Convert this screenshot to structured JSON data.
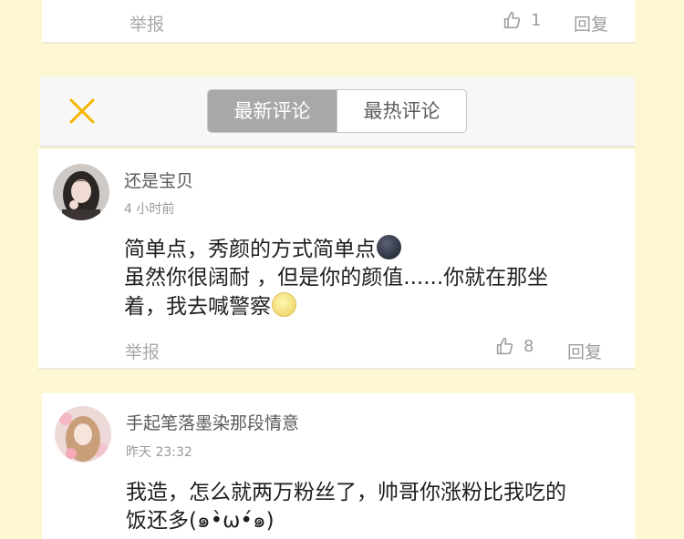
{
  "top_card": {
    "report_label": "举报",
    "like_count": "1",
    "reply_label": "回复"
  },
  "tabs": {
    "latest_label": "最新评论",
    "hot_label": "最热评论",
    "active": "latest"
  },
  "comments": [
    {
      "username": "还是宝贝",
      "time": "4 小时前",
      "lines": [
        "简单点，秀颜的方式简单点",
        "虽然你很阔耐 ，但是你的颜值......你就在那坐",
        "着，我去喊警察"
      ],
      "emojis": [
        "new-moon-face-icon",
        "full-moon-face-icon"
      ],
      "report_label": "举报",
      "like_count": "8",
      "reply_label": "回复"
    },
    {
      "username": "手起笔落墨染那段情意",
      "time": "昨天 23:32",
      "lines": [
        "我造，怎么就两万粉丝了，帅哥你涨粉比我吃的",
        "饭还多(๑•̀ω•́๑)"
      ]
    }
  ],
  "colors": {
    "page_background": "#fdf8d2",
    "close_icon": "#f5b400",
    "active_tab": "#a8a8a8"
  }
}
